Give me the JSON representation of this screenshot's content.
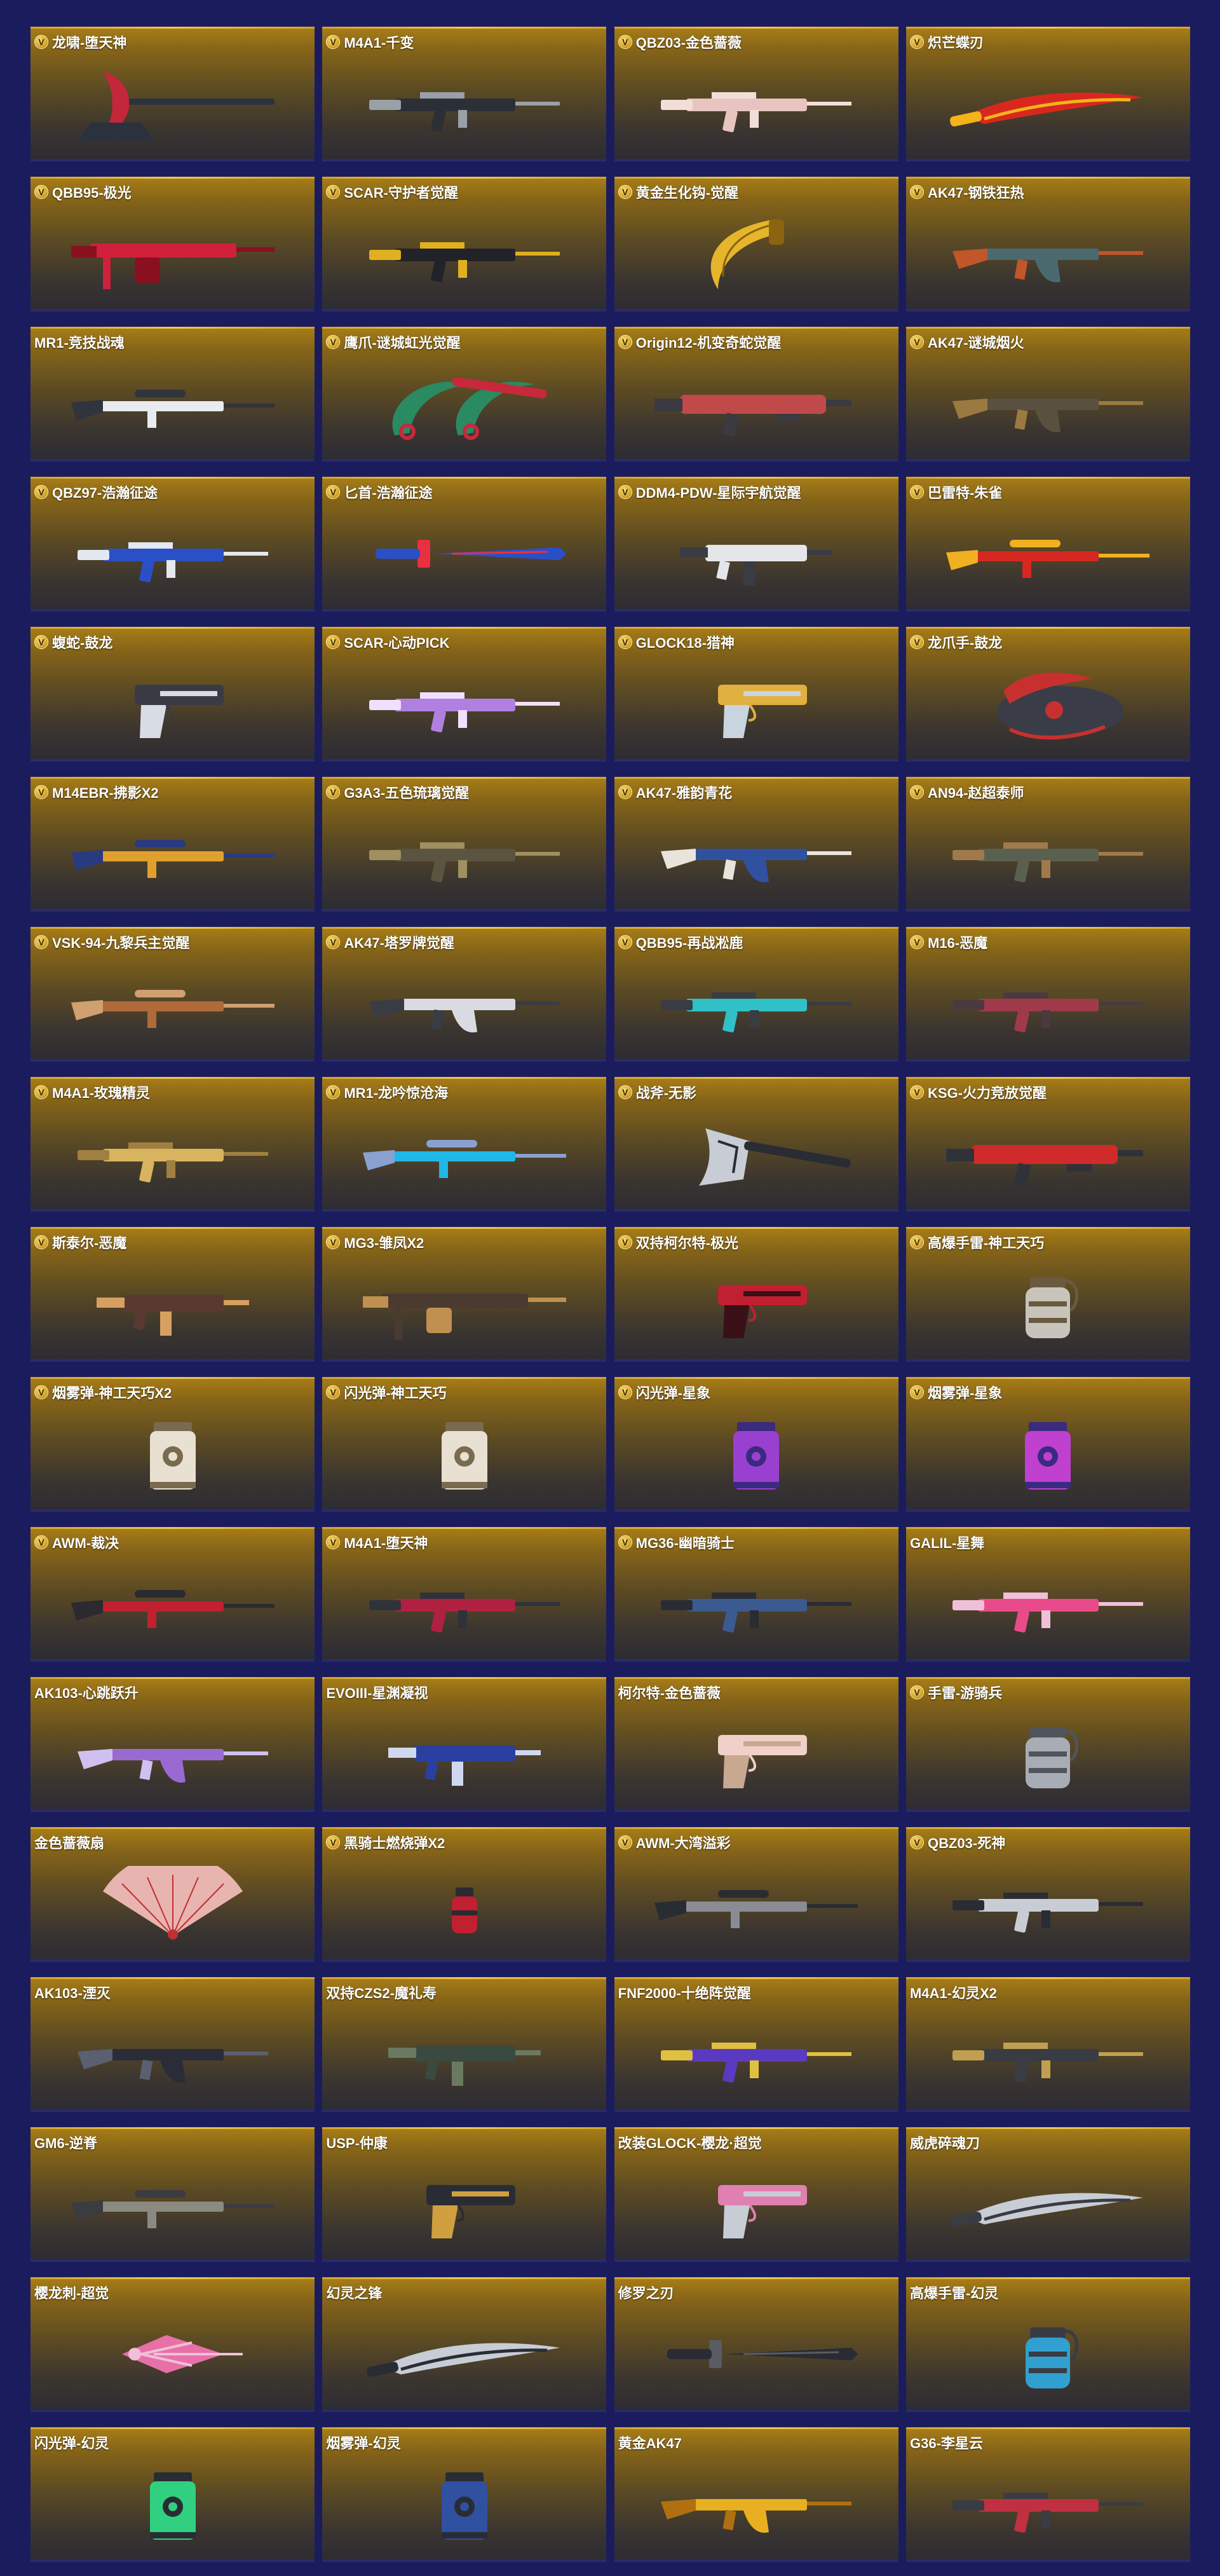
{
  "colors": {
    "background": "#1b1c5e",
    "card_top": "#a87e17",
    "card_bottom": "#2d2c33",
    "badge": "#d6a52a",
    "name_text": "#ffffff"
  },
  "badge_letter": "V",
  "items": [
    {
      "name": "龙啸-堕天神",
      "v": true,
      "icon": "vip-axe-icon",
      "art": "axe",
      "c1": "#2a3240",
      "c2": "#c4263a"
    },
    {
      "name": "M4A1-千变",
      "v": true,
      "icon": "vip-rifle-icon",
      "art": "rifle",
      "c1": "#2c2f36",
      "c2": "#9aa0a8"
    },
    {
      "name": "QBZ03-金色蔷薇",
      "v": true,
      "icon": "vip-rifle-icon",
      "art": "rifle",
      "c1": "#e8c4c0",
      "c2": "#f2ded8"
    },
    {
      "name": "炽芒蝶刃",
      "v": true,
      "icon": "vip-knife-icon",
      "art": "knife",
      "c1": "#d8281e",
      "c2": "#f4b31a"
    },
    {
      "name": "QBB95-极光",
      "v": true,
      "icon": "vip-mg-icon",
      "art": "mg",
      "c1": "#d0203c",
      "c2": "#8a1020"
    },
    {
      "name": "SCAR-守护者觉醒",
      "v": true,
      "icon": "vip-rifle-icon",
      "art": "rifle",
      "c1": "#222328",
      "c2": "#e0b020"
    },
    {
      "name": "黄金生化钩-觉醒",
      "v": true,
      "icon": "vip-claw-icon",
      "art": "claw",
      "c1": "#e6b52c",
      "c2": "#8a6410"
    },
    {
      "name": "AK47-钢铁狂热",
      "v": true,
      "icon": "vip-rifle-icon",
      "art": "ak",
      "c1": "#4a6a70",
      "c2": "#c0562a"
    },
    {
      "name": "MR1-竞技战魂",
      "v": false,
      "icon": "",
      "art": "sniper",
      "c1": "#e8ecf0",
      "c2": "#30343c"
    },
    {
      "name": "鹰爪-谜城虹光觉醒",
      "v": true,
      "icon": "vip-claw-icon",
      "art": "karambit",
      "c1": "#2a8a62",
      "c2": "#c8283c"
    },
    {
      "name": "Origin12-机变奇蛇觉醒",
      "v": true,
      "icon": "vip-shotgun-icon",
      "art": "shotgun",
      "c1": "#c04a4a",
      "c2": "#3a3a40"
    },
    {
      "name": "AK47-谜城烟火",
      "v": true,
      "icon": "vip-rifle-icon",
      "art": "ak",
      "c1": "#5a5040",
      "c2": "#9a7a40"
    },
    {
      "name": "QBZ97-浩瀚征途",
      "v": true,
      "icon": "vip-rifle-icon",
      "art": "rifle",
      "c1": "#2a50c8",
      "c2": "#e4e8f0"
    },
    {
      "name": "匕首-浩瀚征途",
      "v": true,
      "icon": "vip-knife-icon",
      "art": "dagger",
      "c1": "#2a50c8",
      "c2": "#e83040"
    },
    {
      "name": "DDM4-PDW-星际宇航觉醒",
      "v": true,
      "icon": "vip-smg-icon",
      "art": "smg",
      "c1": "#e4e6ea",
      "c2": "#3a3c44"
    },
    {
      "name": "巴雷特-朱雀",
      "v": true,
      "icon": "vip-sniper-icon",
      "art": "sniper",
      "c1": "#d62820",
      "c2": "#f0b020"
    },
    {
      "name": "蝮蛇-鼓龙",
      "v": true,
      "icon": "vip-pistol-icon",
      "art": "pistol",
      "c1": "#3a3a44",
      "c2": "#d8dce4"
    },
    {
      "name": "SCAR-心动PICK",
      "v": true,
      "icon": "vip-rifle-icon",
      "art": "rifle",
      "c1": "#b080e0",
      "c2": "#f0e0ff"
    },
    {
      "name": "GLOCK18-猎神",
      "v": true,
      "icon": "vip-pistol-icon",
      "art": "pistol",
      "c1": "#e0b040",
      "c2": "#c8d4e0"
    },
    {
      "name": "龙爪手-鼓龙",
      "v": true,
      "icon": "vip-claw-icon",
      "art": "gauntlet",
      "c1": "#3a3c48",
      "c2": "#c83030"
    },
    {
      "name": "M14EBR-拂影X2",
      "v": true,
      "icon": "vip-rifle-icon",
      "art": "sniper",
      "c1": "#e0a030",
      "c2": "#2a3a80"
    },
    {
      "name": "G3A3-五色琉璃觉醒",
      "v": true,
      "icon": "vip-rifle-icon",
      "art": "rifle",
      "c1": "#5a5440",
      "c2": "#a09060"
    },
    {
      "name": "AK47-雅韵青花",
      "v": true,
      "icon": "vip-rifle-icon",
      "art": "ak",
      "c1": "#3050a0",
      "c2": "#e8e4dc"
    },
    {
      "name": "AN94-赵超泰师",
      "v": true,
      "icon": "vip-rifle-icon",
      "art": "rifle",
      "c1": "#5a6050",
      "c2": "#a07a4a"
    },
    {
      "name": "VSK-94-九黎兵主觉醒",
      "v": true,
      "icon": "vip-rifle-icon",
      "art": "sniper",
      "c1": "#b06a3a",
      "c2": "#d0a070"
    },
    {
      "name": "AK47-塔罗牌觉醒",
      "v": true,
      "icon": "vip-rifle-icon",
      "art": "ak",
      "c1": "#d8dce2",
      "c2": "#3a3c44"
    },
    {
      "name": "QBB95-再战凇鹿",
      "v": true,
      "icon": "vip-mg-icon",
      "art": "rifle",
      "c1": "#30c0c8",
      "c2": "#3a3c44"
    },
    {
      "name": "M16-恶魔",
      "v": true,
      "icon": "vip-rifle-icon",
      "art": "rifle",
      "c1": "#a03a4a",
      "c2": "#4a3a40"
    },
    {
      "name": "M4A1-玫瑰精灵",
      "v": true,
      "icon": "vip-rifle-icon",
      "art": "rifle",
      "c1": "#d8b460",
      "c2": "#a08040"
    },
    {
      "name": "MR1-龙吟惊沧海",
      "v": true,
      "icon": "vip-sniper-icon",
      "art": "sniper",
      "c1": "#20b8e8",
      "c2": "#8aa0d0"
    },
    {
      "name": "战斧-无影",
      "v": true,
      "icon": "vip-axe-icon",
      "art": "hatchet",
      "c1": "#c8ccd4",
      "c2": "#2a2c34"
    },
    {
      "name": "KSG-火力竞放觉醒",
      "v": true,
      "icon": "vip-shotgun-icon",
      "art": "shotgun",
      "c1": "#d02a2a",
      "c2": "#30323a"
    },
    {
      "name": "斯泰尔-恶魔",
      "v": true,
      "icon": "vip-smg-icon",
      "art": "smg",
      "c1": "#5a3a30",
      "c2": "#d8a060"
    },
    {
      "name": "MG3-雏凤X2",
      "v": true,
      "icon": "vip-mg-icon",
      "art": "mg",
      "c1": "#4a3a30",
      "c2": "#c09050"
    },
    {
      "name": "双持柯尔特-极光",
      "v": true,
      "icon": "vip-pistol-icon",
      "art": "pistol",
      "c1": "#c02030",
      "c2": "#3a1018"
    },
    {
      "name": "高爆手雷-神工天巧",
      "v": true,
      "icon": "vip-grenade-icon",
      "art": "grenade",
      "c1": "#c8c4bc",
      "c2": "#6a5a40"
    },
    {
      "name": "烟雾弹-神工天巧X2",
      "v": true,
      "icon": "vip-grenade-icon",
      "art": "canister",
      "c1": "#e8e0d0",
      "c2": "#7a6a50"
    },
    {
      "name": "闪光弹-神工天巧",
      "v": true,
      "icon": "vip-grenade-icon",
      "art": "canister",
      "c1": "#e8e0d0",
      "c2": "#7a6a50"
    },
    {
      "name": "闪光弹-星象",
      "v": true,
      "icon": "vip-grenade-icon",
      "art": "canister",
      "c1": "#9a40d0",
      "c2": "#3a2a80"
    },
    {
      "name": "烟雾弹-星象",
      "v": true,
      "icon": "vip-grenade-icon",
      "art": "canister",
      "c1": "#c040d0",
      "c2": "#3a2a80"
    },
    {
      "name": "AWM-裁决",
      "v": true,
      "icon": "vip-sniper-icon",
      "art": "sniper",
      "c1": "#c02030",
      "c2": "#2a2a30"
    },
    {
      "name": "M4A1-堕天神",
      "v": true,
      "icon": "vip-rifle-icon",
      "art": "rifle",
      "c1": "#b02040",
      "c2": "#30323a"
    },
    {
      "name": "MG36-幽暗骑士",
      "v": true,
      "icon": "vip-mg-icon",
      "art": "rifle",
      "c1": "#3a5a90",
      "c2": "#2a2c34"
    },
    {
      "name": "GALIL-星舞",
      "v": false,
      "icon": "",
      "art": "rifle",
      "c1": "#e84a8a",
      "c2": "#f0c0d8"
    },
    {
      "name": "AK103-心跳跃升",
      "v": false,
      "icon": "",
      "art": "ak",
      "c1": "#9a6ad0",
      "c2": "#d0c0f0"
    },
    {
      "name": "EVOIII-星渊凝视",
      "v": false,
      "icon": "",
      "art": "smg",
      "c1": "#2a40a0",
      "c2": "#d0d8f0"
    },
    {
      "name": "柯尔特-金色蔷薇",
      "v": false,
      "icon": "",
      "art": "pistol",
      "c1": "#f0d0c8",
      "c2": "#c8a890"
    },
    {
      "name": "手雷-游骑兵",
      "v": true,
      "icon": "vip-grenade-icon",
      "art": "grenade",
      "c1": "#a8acb4",
      "c2": "#50545c"
    },
    {
      "name": "金色蔷薇扇",
      "v": false,
      "icon": "",
      "art": "fan",
      "c1": "#e8b4b0",
      "c2": "#c03030"
    },
    {
      "name": "黑骑士燃烧弹X2",
      "v": true,
      "icon": "vip-grenade-icon",
      "art": "molotov",
      "c1": "#c02030",
      "c2": "#2a2a30"
    },
    {
      "name": "AWM-大湾溢彩",
      "v": true,
      "icon": "vip-sniper-icon",
      "art": "sniper",
      "c1": "#8a8c94",
      "c2": "#2a2c34"
    },
    {
      "name": "QBZ03-死神",
      "v": true,
      "icon": "vip-rifle-icon",
      "art": "rifle",
      "c1": "#c8ccd4",
      "c2": "#2a2c34"
    },
    {
      "name": "AK103-湮灭",
      "v": false,
      "icon": "",
      "art": "ak",
      "c1": "#2a2c38",
      "c2": "#5a6070"
    },
    {
      "name": "双持CZS2-魔礼寿",
      "v": false,
      "icon": "",
      "art": "smg",
      "c1": "#3a4a40",
      "c2": "#6a7a60"
    },
    {
      "name": "FNF2000-十绝阵觉醒",
      "v": false,
      "icon": "",
      "art": "rifle",
      "c1": "#5a3ac0",
      "c2": "#e0c040"
    },
    {
      "name": "M4A1-幻灵X2",
      "v": false,
      "icon": "",
      "art": "rifle",
      "c1": "#3a3c44",
      "c2": "#c0a050"
    },
    {
      "name": "GM6-逆脊",
      "v": false,
      "icon": "",
      "art": "sniper",
      "c1": "#8a8a80",
      "c2": "#3a3c40"
    },
    {
      "name": "USP-仲康",
      "v": false,
      "icon": "",
      "art": "pistol",
      "c1": "#2a2c34",
      "c2": "#d0a040"
    },
    {
      "name": "改装GLOCK-樱龙·超觉",
      "v": false,
      "icon": "",
      "art": "pistol",
      "c1": "#e080b0",
      "c2": "#c8ccd4"
    },
    {
      "name": "威虎碎魂刀",
      "v": false,
      "icon": "",
      "art": "knife",
      "c1": "#c8ccd4",
      "c2": "#3a3c44"
    },
    {
      "name": "樱龙刺-超觉",
      "v": false,
      "icon": "",
      "art": "spike",
      "c1": "#e870a8",
      "c2": "#f0c0d8"
    },
    {
      "name": "幻灵之锋",
      "v": false,
      "icon": "",
      "art": "knife",
      "c1": "#c8ccd4",
      "c2": "#2a2c34"
    },
    {
      "name": "修罗之刃",
      "v": false,
      "icon": "",
      "art": "dagger",
      "c1": "#2a2c34",
      "c2": "#5a5c64"
    },
    {
      "name": "高爆手雷-幻灵",
      "v": false,
      "icon": "",
      "art": "grenade",
      "c1": "#30a0d0",
      "c2": "#3a3c44"
    },
    {
      "name": "闪光弹-幻灵",
      "v": false,
      "icon": "",
      "art": "canister",
      "c1": "#30d080",
      "c2": "#2a2c34"
    },
    {
      "name": "烟雾弹-幻灵",
      "v": false,
      "icon": "",
      "art": "canister",
      "c1": "#3050a0",
      "c2": "#2a2c34"
    },
    {
      "name": "黄金AK47",
      "v": false,
      "icon": "",
      "art": "ak",
      "c1": "#e8b020",
      "c2": "#b07010"
    },
    {
      "name": "G36-李星云",
      "v": false,
      "icon": "",
      "art": "rifle",
      "c1": "#c03040",
      "c2": "#3a3c44"
    }
  ]
}
